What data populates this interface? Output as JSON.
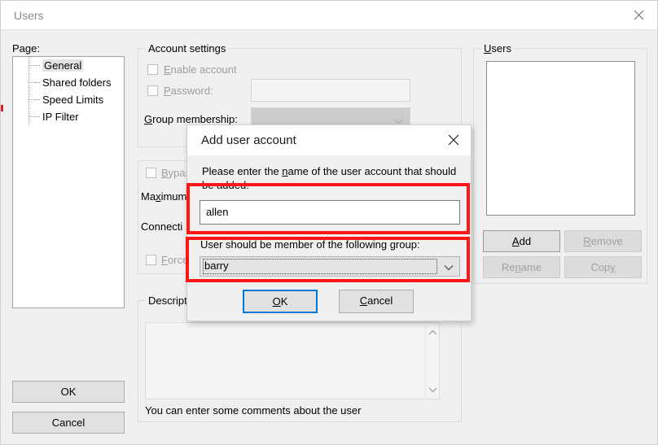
{
  "window": {
    "title": "Users",
    "close_icon": "close-icon"
  },
  "left_panel": {
    "page_label": "Page:",
    "tree_items": [
      {
        "label": "General",
        "selected": true
      },
      {
        "label": "Shared folders",
        "selected": false
      },
      {
        "label": "Speed Limits",
        "selected": false
      },
      {
        "label": "IP Filter",
        "selected": false
      }
    ],
    "ok_label": "OK",
    "cancel_label": "Cancel"
  },
  "account_settings": {
    "legend": "Account settings",
    "enable_account": "Enable account",
    "password": "Password:",
    "group_membership": "Group membership:",
    "group_membership_value": "",
    "password_value": "",
    "enabled": false
  },
  "connection_settings": {
    "bypass": "Bypas",
    "maximum": "Maximum",
    "connection": "Connecti",
    "force": "Force"
  },
  "description": {
    "legend": "Description",
    "legend_visible": "Descriptio",
    "value": "",
    "hint": "You can enter some comments about the user",
    "scroll_up_icon": "chevron-up-icon",
    "scroll_down_icon": "chevron-down-icon"
  },
  "users_panel": {
    "legend": "Users",
    "list_items": [],
    "buttons": [
      {
        "label": "Add",
        "enabled": true,
        "accel": "A"
      },
      {
        "label": "Remove",
        "enabled": false,
        "accel": "R"
      },
      {
        "label": "Rename",
        "enabled": false,
        "accel": "n"
      },
      {
        "label": "Copy",
        "enabled": false,
        "accel": "y"
      }
    ]
  },
  "dialog": {
    "title": "Add user account",
    "close_icon": "close-icon",
    "prompt": "Please enter the name of the user account that should be added:",
    "name_value": "allen",
    "group_label": "User should be member of the following group:",
    "group_value": "barry",
    "dropdown_icon": "chevron-down-icon",
    "ok_label": "OK",
    "cancel_label": "Cancel"
  },
  "annotations": {
    "highlight_color": "#ff1616",
    "focus_color": "#0078d7",
    "boxes": [
      {
        "name": "name-input-highlight"
      },
      {
        "name": "group-combo-highlight"
      }
    ]
  }
}
